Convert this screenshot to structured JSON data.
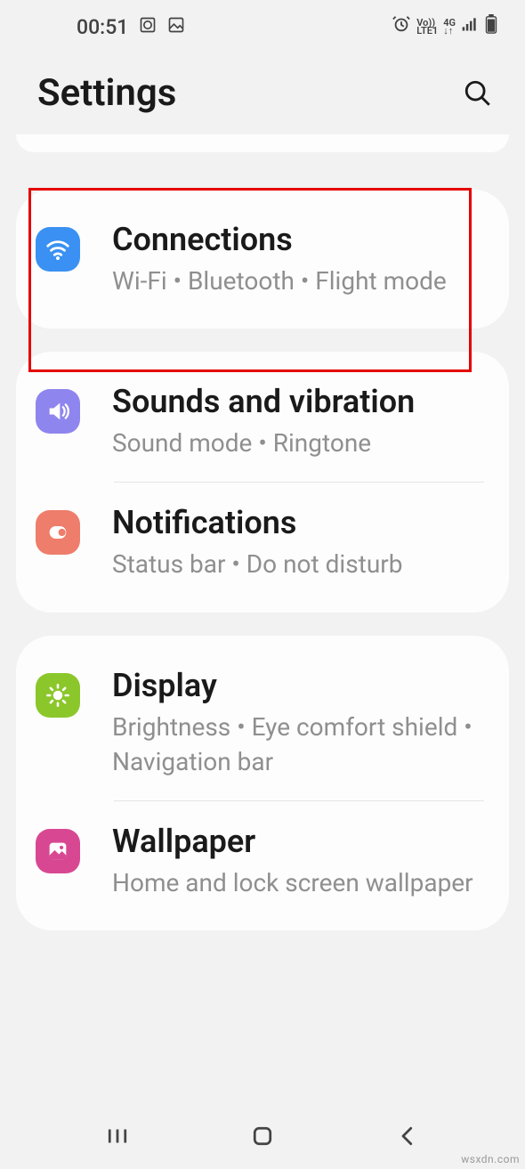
{
  "status": {
    "time": "00:51",
    "volte_top": "Vo))",
    "volte_bot": "LTE1",
    "net": "4G"
  },
  "header": {
    "title": "Settings"
  },
  "groups": [
    {
      "items": [
        {
          "id": "connections",
          "title": "Connections",
          "sub": "Wi‑Fi  •  Bluetooth  •  Flight mode",
          "icon": "wifi-icon",
          "iconClass": "icon-blue"
        }
      ]
    },
    {
      "items": [
        {
          "id": "sounds",
          "title": "Sounds and vibration",
          "sub": "Sound mode  •  Ringtone",
          "icon": "sound-icon",
          "iconClass": "icon-purple"
        },
        {
          "id": "notifications",
          "title": "Notifications",
          "sub": "Status bar  •  Do not disturb",
          "icon": "notifications-icon",
          "iconClass": "icon-coral"
        }
      ]
    },
    {
      "items": [
        {
          "id": "display",
          "title": "Display",
          "sub": "Brightness  •  Eye comfort shield  •  Navigation bar",
          "icon": "display-icon",
          "iconClass": "icon-green"
        },
        {
          "id": "wallpaper",
          "title": "Wallpaper",
          "sub": "Home and lock screen wallpaper",
          "icon": "wallpaper-icon",
          "iconClass": "icon-pink"
        }
      ]
    }
  ],
  "watermark": "wsxdn.com"
}
